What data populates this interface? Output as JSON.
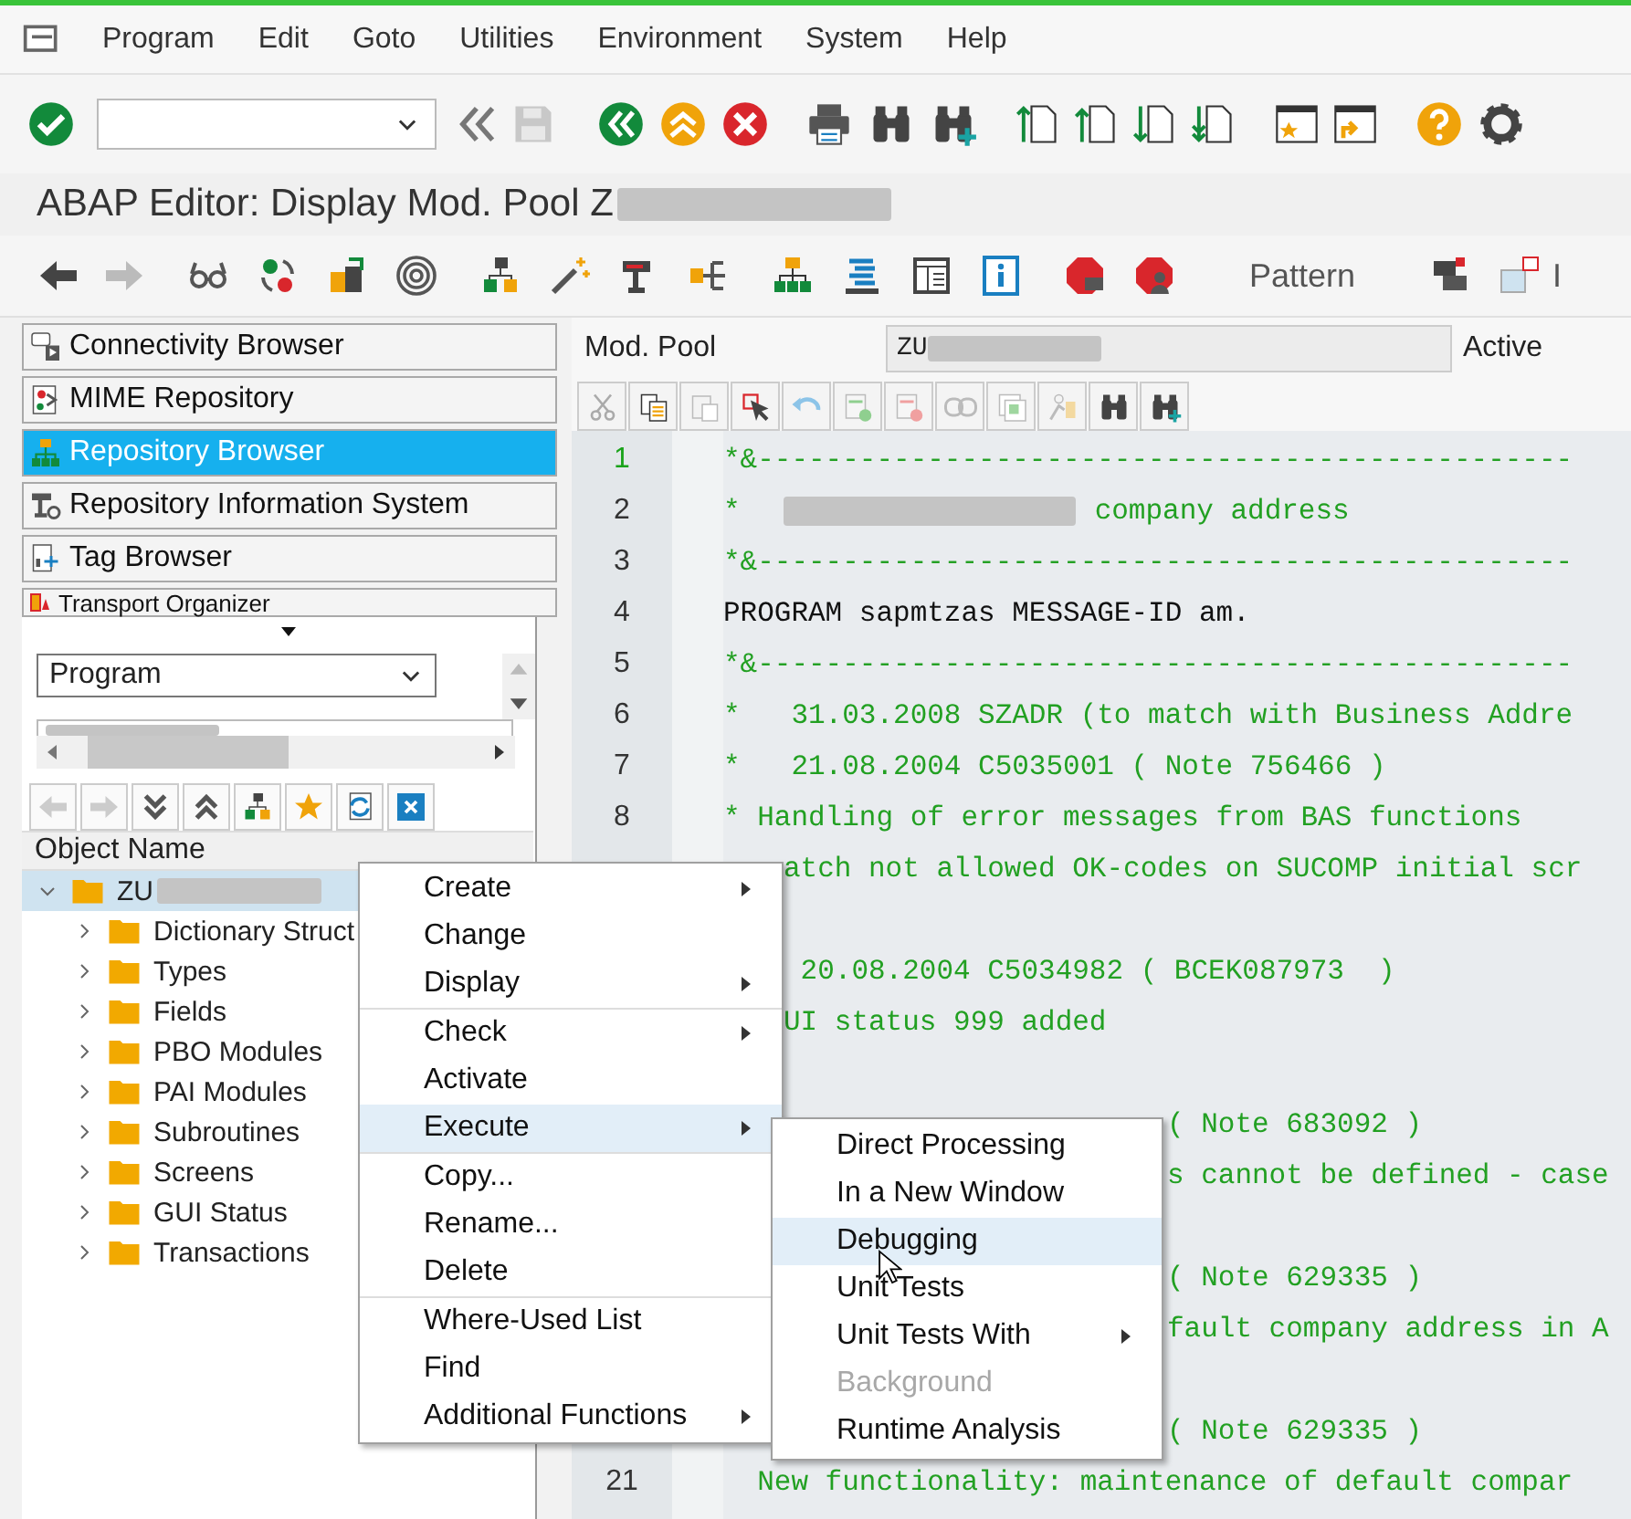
{
  "menu_bar": [
    "Program",
    "Edit",
    "Goto",
    "Utilities",
    "Environment",
    "System",
    "Help"
  ],
  "title": "ABAP Editor: Display Mod. Pool Z",
  "app_toolbar": {
    "pattern": "Pattern",
    "cut_label": "I"
  },
  "browsers": [
    {
      "label": "Connectivity Browser",
      "selected": false
    },
    {
      "label": "MIME Repository",
      "selected": false
    },
    {
      "label": "Repository Browser",
      "selected": true
    },
    {
      "label": "Repository Information System",
      "selected": false
    },
    {
      "label": "Tag Browser",
      "selected": false
    },
    {
      "label": "Transport Organizer",
      "selected": false
    }
  ],
  "object_type": {
    "value": "Program"
  },
  "tree": {
    "header": "Object Name",
    "root": {
      "label": "ZU",
      "expanded": true,
      "selected": true,
      "children": [
        {
          "label": "Dictionary Struct",
          "expanded": false,
          "selected": false
        },
        {
          "label": "Types",
          "expanded": false,
          "selected": false
        },
        {
          "label": "Fields",
          "expanded": false,
          "selected": false
        },
        {
          "label": "PBO Modules",
          "expanded": false,
          "selected": false
        },
        {
          "label": "PAI Modules",
          "expanded": false,
          "selected": false
        },
        {
          "label": "Subroutines",
          "expanded": false,
          "selected": false
        },
        {
          "label": "Screens",
          "expanded": false,
          "selected": false
        },
        {
          "label": "GUI Status",
          "expanded": false,
          "selected": false
        },
        {
          "label": "Transactions",
          "expanded": false,
          "selected": false
        }
      ]
    }
  },
  "editor": {
    "type_label": "Mod. Pool",
    "name": "ZU",
    "status": "Active",
    "lines": [
      {
        "number": "1",
        "text": "*&------------------------------------------------",
        "kind": "comment",
        "current": true
      },
      {
        "number": "2",
        "text": "*",
        "text_after": "company address",
        "kind": "comment",
        "current": false,
        "redacted": true
      },
      {
        "number": "3",
        "text": "*&------------------------------------------------",
        "kind": "comment",
        "current": false
      },
      {
        "number": "4",
        "text": "PROGRAM sapmtzas MESSAGE-ID am.",
        "kind": "code",
        "current": false
      },
      {
        "number": "5",
        "text": "*&------------------------------------------------",
        "kind": "comment",
        "current": false
      },
      {
        "number": "6",
        "text": "*   31.03.2008 SZADR (to match with Business Addre",
        "kind": "comment",
        "current": false
      },
      {
        "number": "7",
        "text": "*   21.08.2004 C5035001 ( Note 756466 )",
        "kind": "comment",
        "current": false
      },
      {
        "number": "8",
        "text": "* Handling of error messages from BAS functions",
        "kind": "comment",
        "current": false
      },
      {
        "text": "atch not allowed OK-codes on SUCOMP initial scr",
        "kind": "comment"
      },
      {
        "kind": "blank"
      },
      {
        "text": " 20.08.2004 C5034982 ( BCEK087973  )",
        "kind": "comment"
      },
      {
        "text": "UI status 999 added",
        "kind": "comment"
      },
      {
        "kind": "blank"
      },
      {
        "text": "( Note 683092 )",
        "kind": "comment"
      },
      {
        "text": "s cannot be defined - case",
        "kind": "comment"
      },
      {
        "kind": "blank"
      },
      {
        "text": "( Note 629335 )",
        "kind": "comment"
      },
      {
        "text": "fault company address in A",
        "kind": "comment"
      },
      {
        "kind": "blank"
      },
      {
        "text": "( Note 629335 )",
        "kind": "comment"
      },
      {
        "number": "21",
        "text": "  New functionality: maintenance of default compar",
        "kind": "comment",
        "current": false
      }
    ]
  },
  "context_menu": {
    "groups": [
      [
        {
          "label": "Create",
          "has_submenu": true,
          "selected": false
        },
        {
          "label": "Change",
          "has_submenu": false,
          "selected": false
        },
        {
          "label": "Display",
          "has_submenu": true,
          "selected": false
        }
      ],
      [
        {
          "label": "Check",
          "has_submenu": true,
          "selected": false
        },
        {
          "label": "Activate",
          "has_submenu": false,
          "selected": false
        },
        {
          "label": "Execute",
          "has_submenu": true,
          "selected": true
        }
      ],
      [
        {
          "label": "Copy...",
          "has_submenu": false,
          "selected": false
        },
        {
          "label": "Rename...",
          "has_submenu": false,
          "selected": false
        },
        {
          "label": "Delete",
          "has_submenu": false,
          "selected": false
        }
      ],
      [
        {
          "label": "Where-Used List",
          "has_submenu": false,
          "selected": false
        },
        {
          "label": "Find",
          "has_submenu": false,
          "selected": false
        },
        {
          "label": "Additional Functions",
          "has_submenu": true,
          "selected": false
        }
      ]
    ]
  },
  "submenu": {
    "items": [
      {
        "label": "Direct Processing",
        "has_submenu": false,
        "selected": false,
        "disabled": false
      },
      {
        "label": "In a New Window",
        "has_submenu": false,
        "selected": false,
        "disabled": false
      },
      {
        "label": "Debugging",
        "has_submenu": false,
        "selected": true,
        "disabled": false
      },
      {
        "label": "Unit Tests",
        "has_submenu": false,
        "selected": false,
        "disabled": false
      },
      {
        "label": "Unit Tests With",
        "has_submenu": true,
        "selected": false,
        "disabled": false
      },
      {
        "label": "Background",
        "has_submenu": false,
        "selected": false,
        "disabled": true
      },
      {
        "label": "Runtime Analysis",
        "has_submenu": false,
        "selected": false,
        "disabled": false
      }
    ]
  }
}
